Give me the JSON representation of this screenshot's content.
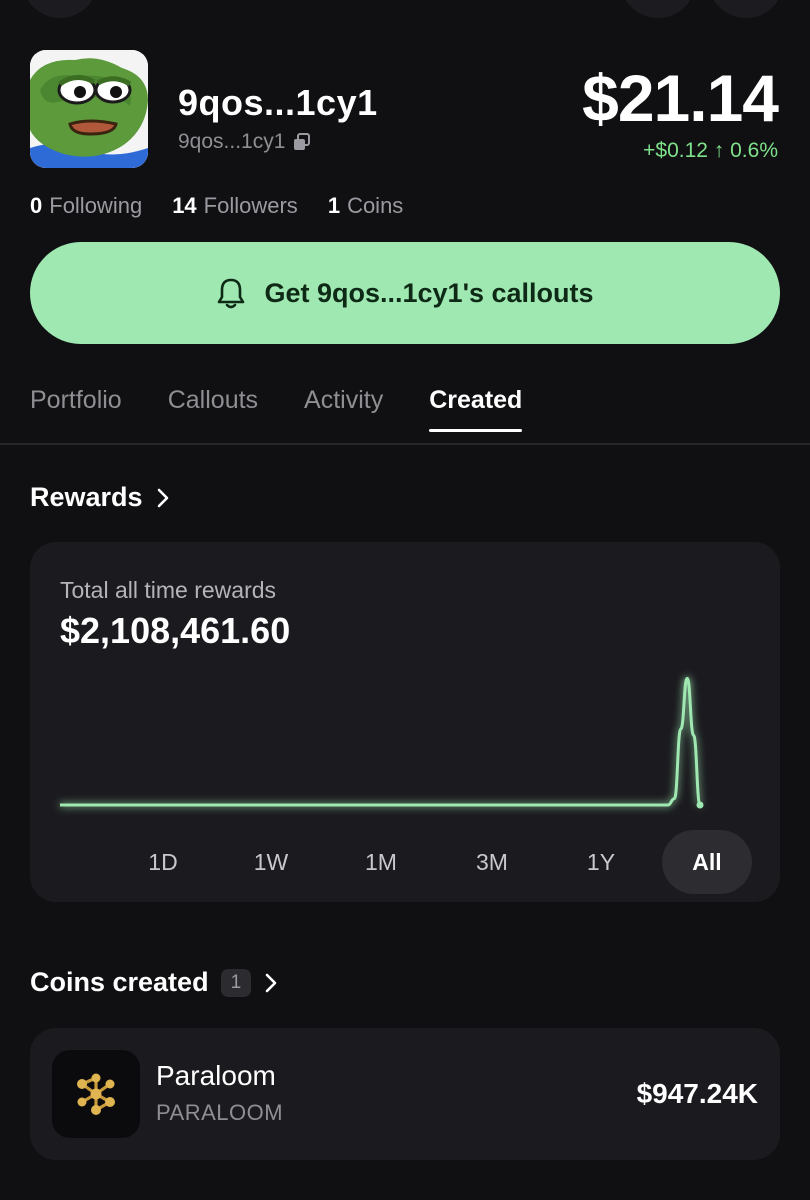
{
  "profile": {
    "username": "9qos...1cy1",
    "handle": "9qos...1cy1",
    "avatar_icon": "pepe-frog-avatar",
    "balance": "$21.14",
    "change": "+$0.12 ↑ 0.6%",
    "change_color": "#7ee08a"
  },
  "social": {
    "following_count": "0",
    "following_label": "Following",
    "followers_count": "14",
    "followers_label": "Followers",
    "coins_count": "1",
    "coins_label": "Coins"
  },
  "cta": {
    "label": "Get 9qos...1cy1's callouts",
    "icon": "bell-icon",
    "color": "#9fe8b1"
  },
  "tabs": [
    {
      "label": "Portfolio",
      "active": false
    },
    {
      "label": "Callouts",
      "active": false
    },
    {
      "label": "Activity",
      "active": false
    },
    {
      "label": "Created",
      "active": true
    }
  ],
  "rewards": {
    "title": "Rewards",
    "total_label": "Total all time rewards",
    "total_value": "$2,108,461.60",
    "ranges": [
      "1D",
      "1W",
      "1M",
      "3M",
      "1Y",
      "All"
    ],
    "selected_range": "All"
  },
  "chart_data": {
    "type": "line",
    "title": "",
    "xlabel": "",
    "ylabel": "",
    "x": [
      0,
      10,
      20,
      30,
      40,
      50,
      60,
      70,
      80,
      90,
      95,
      96,
      97,
      98,
      99,
      100
    ],
    "series": [
      {
        "values": [
          0,
          0,
          0,
          0,
          0,
          0,
          0,
          0,
          0,
          0,
          0,
          0.05,
          0.6,
          1.0,
          0.55,
          0
        ]
      }
    ],
    "ylim": [
      0,
      1.05
    ],
    "grid": false,
    "color": "#9fe8b1"
  },
  "coins_created": {
    "title": "Coins created",
    "count": "1",
    "items": [
      {
        "name": "Paraloom",
        "ticker": "PARALOOM",
        "value": "$947.24K",
        "icon": "paraloom-logo-icon"
      }
    ]
  }
}
